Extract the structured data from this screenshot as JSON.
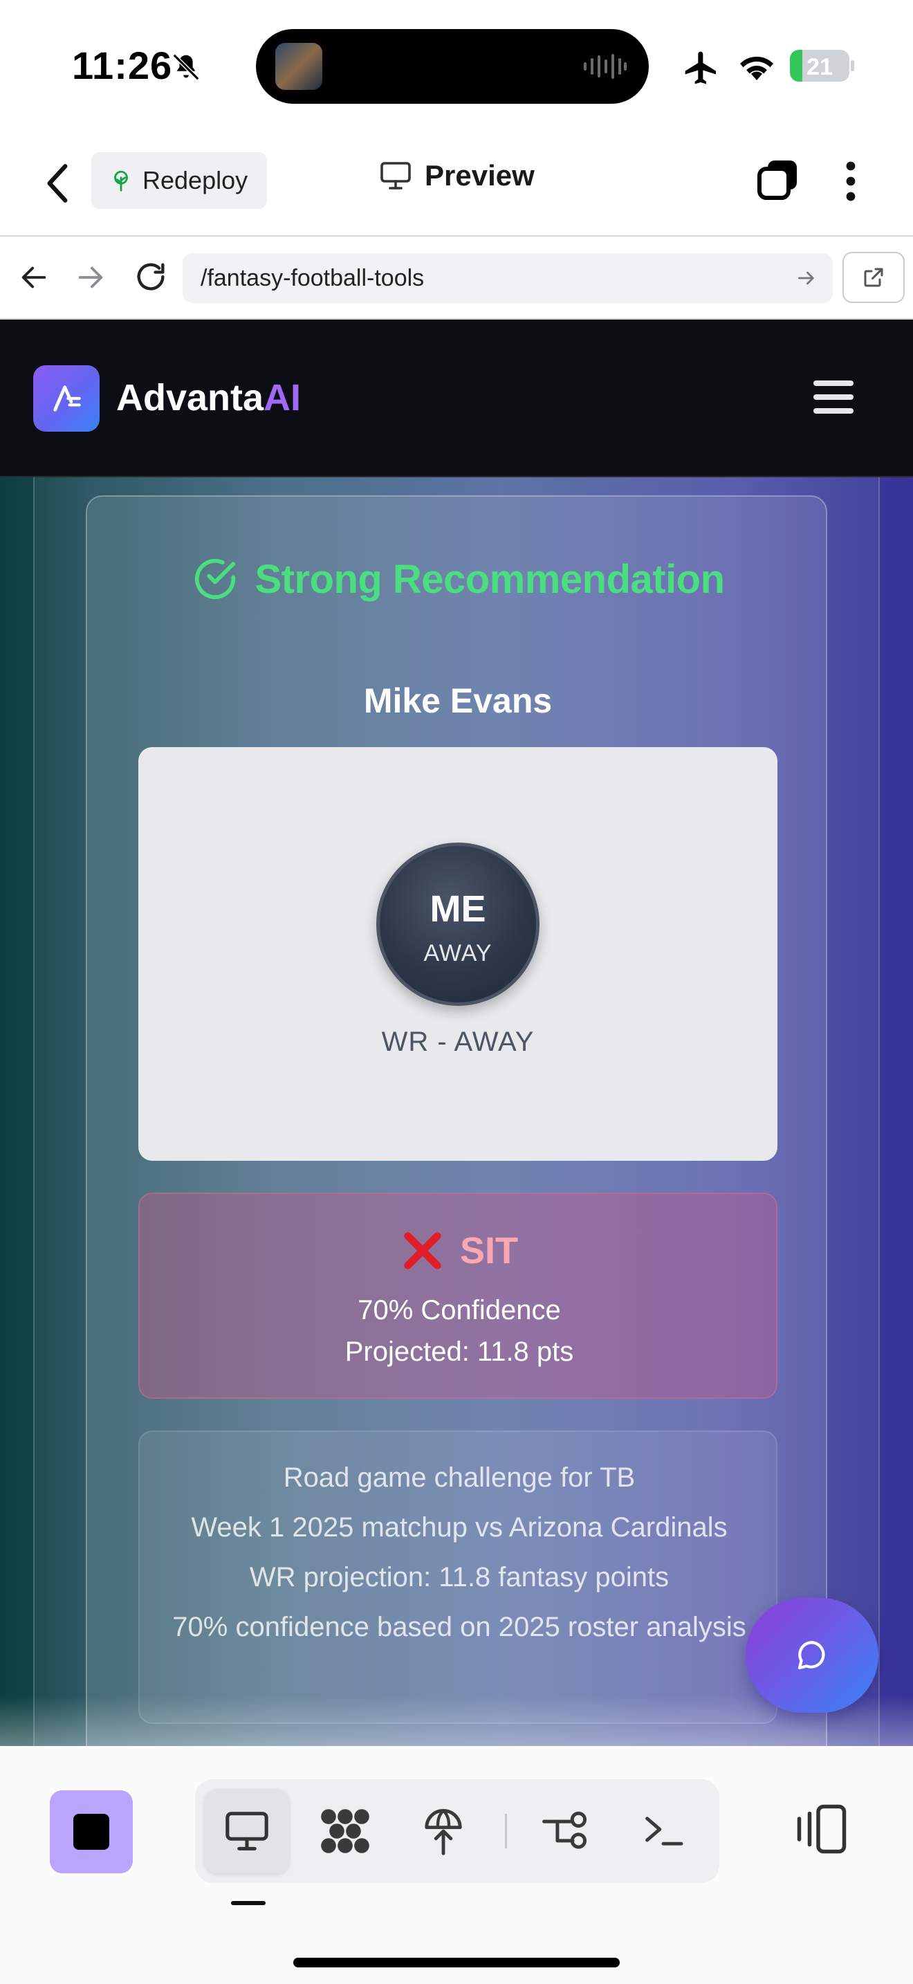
{
  "status_bar": {
    "time": "11:26",
    "battery_percent": "21",
    "battery_level": 0.21,
    "icons": [
      "bell-slash-icon",
      "airplane-icon",
      "wifi-icon",
      "battery-charging-icon"
    ]
  },
  "app_header": {
    "redeploy_label": "Redeploy",
    "preview_label": "Preview"
  },
  "browser": {
    "url": "/fantasy-football-tools"
  },
  "site": {
    "brand_main": "Advanta",
    "brand_accent": "AI",
    "accent_color": "#a069f5"
  },
  "recommendation": {
    "heading": "Strong Recommendation",
    "heading_color": "#4ade80",
    "player_name": "Mike Evans",
    "initials": "ME",
    "location": "AWAY",
    "position_line": "WR - AWAY",
    "verdict": "SIT",
    "confidence_text": "70% Confidence",
    "projection_text": "Projected: 11.8 pts",
    "notes": [
      "Road game challenge for TB",
      "Week 1 2025 matchup vs Arizona Cardinals",
      "WR projection: 11.8 fantasy points",
      "70% confidence based on 2025 roster analysis"
    ]
  },
  "toolbar": {
    "tools": [
      "preview-icon",
      "grid-icon",
      "deploy-icon",
      "git-branch-icon",
      "terminal-icon"
    ],
    "stop_color": "#b9a4ff"
  }
}
